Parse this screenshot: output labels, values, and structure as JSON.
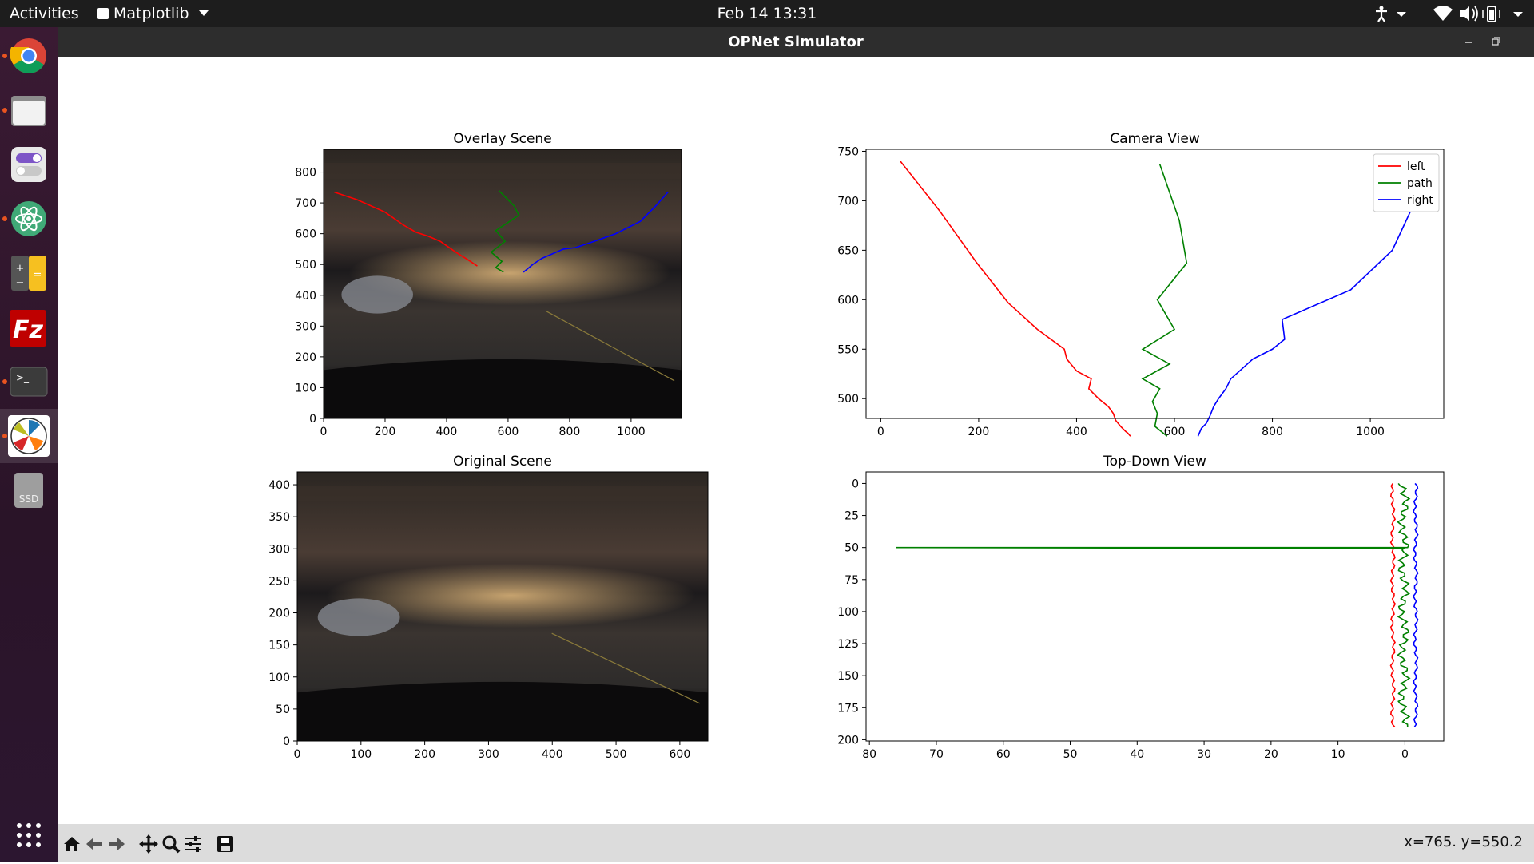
{
  "topbar": {
    "activities": "Activities",
    "app_menu": "Matplotlib",
    "clock": "Feb 14  13:31"
  },
  "dock": {
    "items": [
      "Google Chrome",
      "Files",
      "Settings",
      "Atom",
      "Calculator",
      "FileZilla",
      "Terminal",
      "Matplotlib",
      "SSD"
    ],
    "ssd_label": "SSD"
  },
  "window": {
    "title": "OPNet Simulator"
  },
  "toolbar": {
    "buttons": [
      "home-icon",
      "back-arrow-icon",
      "forward-arrow-icon",
      "pan-icon",
      "zoom-icon",
      "configure-subplots-icon",
      "save-icon"
    ],
    "coords": "x=765. y=550.2"
  },
  "chart_data": [
    {
      "type": "image",
      "title": "Overlay Scene",
      "xlim": [
        0,
        1164
      ],
      "ylim": [
        874,
        0
      ],
      "xticks": [
        0,
        200,
        400,
        600,
        800,
        1000
      ],
      "yticks": [
        0,
        100,
        200,
        300,
        400,
        500,
        600,
        700,
        800
      ],
      "series": [
        {
          "color": "#ff0000",
          "points": [
            [
              35,
              735
            ],
            [
              110,
              710
            ],
            [
              200,
              670
            ],
            [
              260,
              628
            ],
            [
              300,
              605
            ],
            [
              340,
              592
            ],
            [
              380,
              575
            ],
            [
              430,
              540
            ],
            [
              470,
              515
            ],
            [
              500,
              495
            ]
          ]
        },
        {
          "color": "#008000",
          "points": [
            [
              570,
              740
            ],
            [
              620,
              690
            ],
            [
              635,
              660
            ],
            [
              560,
              610
            ],
            [
              590,
              575
            ],
            [
              545,
              540
            ],
            [
              580,
              510
            ],
            [
              560,
              490
            ],
            [
              585,
              475
            ]
          ]
        },
        {
          "color": "#0000ff",
          "points": [
            [
              650,
              475
            ],
            [
              680,
              500
            ],
            [
              710,
              520
            ],
            [
              780,
              550
            ],
            [
              820,
              555
            ],
            [
              880,
              575
            ],
            [
              950,
              600
            ],
            [
              1030,
              640
            ],
            [
              1080,
              690
            ],
            [
              1120,
              735
            ]
          ]
        }
      ]
    },
    {
      "type": "line",
      "title": "Camera View",
      "xlim": [
        -30,
        1150
      ],
      "ylim": [
        752,
        480
      ],
      "xticks": [
        0,
        200,
        400,
        600,
        800,
        1000
      ],
      "yticks": [
        500,
        550,
        600,
        650,
        700,
        750
      ],
      "legend": {
        "position": "top-right",
        "entries": [
          "left",
          "path",
          "right"
        ]
      },
      "series": [
        {
          "name": "left",
          "color": "#ff0000",
          "x": [
            40,
            120,
            195,
            260,
            320,
            375,
            380,
            400,
            430,
            425,
            445,
            465,
            475,
            480,
            490,
            500,
            505,
            510
          ],
          "y": [
            740,
            690,
            638,
            597,
            570,
            550,
            540,
            528,
            520,
            510,
            500,
            492,
            485,
            478,
            472,
            467,
            465,
            462
          ]
        },
        {
          "name": "path",
          "color": "#008000",
          "x": [
            570,
            610,
            625,
            565,
            600,
            535,
            590,
            535,
            570,
            555,
            565,
            560,
            585
          ],
          "y": [
            737,
            680,
            637,
            600,
            570,
            550,
            535,
            520,
            510,
            497,
            485,
            472,
            462
          ]
        },
        {
          "name": "right",
          "color": "#0000ff",
          "x": [
            648,
            655,
            665,
            672,
            680,
            690,
            705,
            715,
            760,
            800,
            825,
            820,
            960,
            1045,
            1125
          ],
          "y": [
            462,
            470,
            475,
            482,
            492,
            500,
            510,
            520,
            540,
            550,
            560,
            580,
            610,
            650,
            735
          ]
        }
      ]
    },
    {
      "type": "image",
      "title": "Original Scene",
      "xlim": [
        0,
        644
      ],
      "ylim": [
        420,
        0
      ],
      "xticks": [
        0,
        100,
        200,
        300,
        400,
        500,
        600
      ],
      "yticks": [
        0,
        50,
        100,
        150,
        200,
        250,
        300,
        350,
        400
      ]
    },
    {
      "type": "line",
      "title": "Top-Down View",
      "xlim": [
        80.5,
        -5.8
      ],
      "ylim": [
        -9,
        201
      ],
      "xticks": [
        80,
        70,
        60,
        50,
        40,
        30,
        20,
        10,
        0
      ],
      "yticks": [
        0,
        25,
        50,
        75,
        100,
        125,
        150,
        175,
        200
      ],
      "series": [
        {
          "name": "left",
          "color": "#ff0000",
          "base_x": 1.8,
          "y_range": [
            0,
            190
          ],
          "jitter": 0.35
        },
        {
          "name": "path",
          "color": "#008000",
          "base_x": 0.2,
          "y_range": [
            0,
            190
          ],
          "jitter": 0.9,
          "spike_y": 50,
          "spike_x": 76
        },
        {
          "name": "right",
          "color": "#0000ff",
          "base_x": -1.6,
          "y_range": [
            0,
            190
          ],
          "jitter": 0.35
        }
      ]
    }
  ]
}
